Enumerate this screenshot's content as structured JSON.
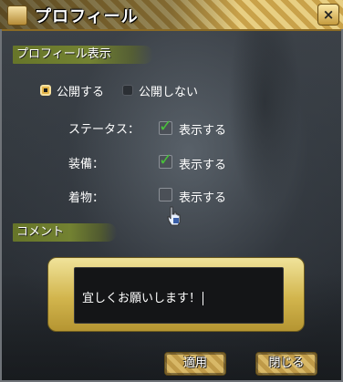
{
  "window": {
    "title": "プロフィール",
    "close_label": "×"
  },
  "profile_display": {
    "header": "プロフィール表示",
    "public_label": "公開する",
    "private_label": "公開しない",
    "public_selected": true
  },
  "settings": [
    {
      "label": "ステータス：",
      "option": "表示する",
      "checked": true
    },
    {
      "label": "装備：",
      "option": "表示する",
      "checked": true
    },
    {
      "label": "着物：",
      "option": "表示する",
      "checked": false
    }
  ],
  "comment": {
    "header": "コメント",
    "value": "宜しくお願いします！"
  },
  "buttons": {
    "apply": "適用",
    "close": "閉じる"
  },
  "colors": {
    "accent_gold": "#d8b867",
    "brush_green": "#7a8a30",
    "check_green": "#48c43a"
  }
}
